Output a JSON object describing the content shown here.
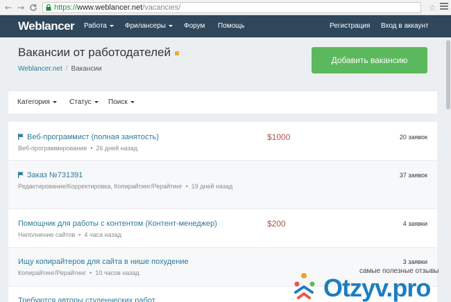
{
  "browser": {
    "url_scheme": "https://",
    "url_host": "www.weblancer.net",
    "url_path": "/vacancies/",
    "back_glyph": "←",
    "forward_glyph": "→",
    "reload_glyph": "C",
    "star_glyph": "☆"
  },
  "nav": {
    "logo_main": "Weblancer",
    "items": [
      {
        "label": "Работа",
        "dropdown": true
      },
      {
        "label": "Фрилансеры",
        "dropdown": true
      },
      {
        "label": "Форум",
        "dropdown": false
      },
      {
        "label": "Помощь",
        "dropdown": false
      }
    ],
    "register": "Регистрация",
    "login": "Вход в аккаунт"
  },
  "header": {
    "title": "Вакансии от работодателей",
    "breadcrumb_home": "Weblancer.net",
    "breadcrumb_sep": "/",
    "breadcrumb_current": "Вакансии",
    "add_button": "Добавить вакансию"
  },
  "filters": {
    "category": "Категория",
    "status": "Статус",
    "search": "Поиск"
  },
  "vacancies": [
    {
      "title": "Веб-программист (полная занятость)",
      "flag": true,
      "category": "Веб-программирование",
      "time": "26 дней назад",
      "price": "$1000",
      "bids": "20 заявок"
    },
    {
      "title": "Заказ №731391",
      "flag": true,
      "category": "Редактирование/Корректировка, Копирайтинг/Рерайтинг",
      "time": "19 дней назад",
      "price": "",
      "bids": "37 заявок"
    },
    {
      "title": "Помощник для работы с контентом (Контент-менеджер)",
      "flag": false,
      "category": "Наполнение сайтов",
      "time": "4 часа назад",
      "price": "$200",
      "bids": "4 заявки"
    },
    {
      "title": "Ищу копирайтеров для сайта в нише похудение",
      "flag": false,
      "category": "Копирайтинг/Рерайтинг",
      "time": "10 часов назад",
      "price": "",
      "bids": "3 заявки"
    },
    {
      "title": "Требуются авторы студенческих работ",
      "flag": false,
      "category": "",
      "time": "",
      "price": "",
      "bids": ""
    }
  ],
  "watermark": {
    "tagline": "самые полезные отзывы",
    "brand": "Otzyv.pro"
  },
  "colors": {
    "nav_bg": "#2f475a",
    "accent_green": "#5cb85c",
    "link_blue": "#2b7a99",
    "price_red": "#b0544c",
    "watermark_blue": "#1c7ec0"
  }
}
